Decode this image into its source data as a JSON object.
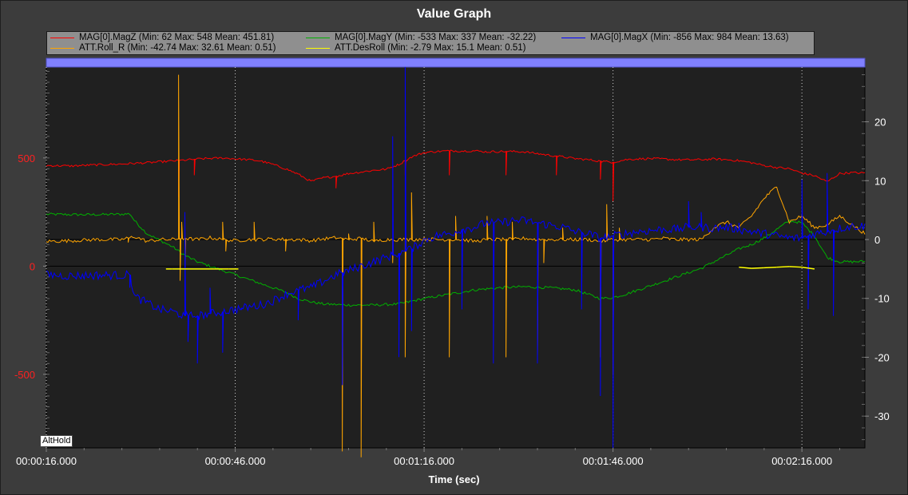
{
  "window": {
    "title": "Value Graph"
  },
  "badge": "AltHold",
  "colors": {
    "plot_bg": "#202020",
    "grid": "#cfcfcf",
    "topbar": "#8080ff"
  },
  "chart_data": {
    "type": "line",
    "title": "Value Graph",
    "xlabel": "Time (sec)",
    "ylabel": "",
    "xlim": [
      16,
      146
    ],
    "ylim_left": [
      -840,
      920
    ],
    "ylim_right": [
      -35.4,
      29.3
    ],
    "x_tick_labels": [
      "00:00:16.000",
      "00:00:46.000",
      "00:01:16.000",
      "00:01:46.000",
      "00:02:16.000"
    ],
    "x_tick_values": [
      16,
      46,
      76,
      106,
      136
    ],
    "y_left_ticks": [
      500,
      0,
      -500
    ],
    "y_left_tick_labels": [
      "500",
      "0",
      "-500"
    ],
    "y_right_ticks": [
      20,
      10,
      0,
      -10,
      -20,
      -30
    ],
    "y_right_tick_labels": [
      "20",
      "10",
      "0",
      "-10",
      "-20",
      "-30"
    ],
    "grid": true,
    "legend": "top",
    "series": [
      {
        "name": "MAG[0].MagZ",
        "legend_label": "MAG[0].MagZ  (Min: 62 Max: 548 Mean: 451.81)",
        "color": "#ff0000",
        "axis": "left",
        "x": [
          16,
          20,
          24,
          28,
          32,
          36,
          38,
          40,
          42,
          44,
          46,
          48,
          50,
          52,
          54,
          56,
          58,
          60,
          62,
          64,
          66,
          68,
          70,
          72,
          74,
          76,
          78,
          80,
          82,
          84,
          86,
          88,
          90,
          92,
          94,
          96,
          98,
          100,
          102,
          104,
          106,
          108,
          110,
          112,
          114,
          116,
          118,
          120,
          122,
          124,
          126,
          128,
          130,
          132,
          134,
          136,
          138,
          140,
          142,
          144,
          146
        ],
        "y": [
          465,
          463,
          468,
          472,
          478,
          486,
          490,
          495,
          498,
          500,
          496,
          492,
          486,
          470,
          450,
          425,
          392,
          408,
          415,
          428,
          435,
          443,
          448,
          470,
          505,
          525,
          530,
          533,
          532,
          533,
          528,
          530,
          530,
          528,
          520,
          512,
          505,
          497,
          492,
          485,
          480,
          492,
          496,
          497,
          495,
          492,
          491,
          492,
          495,
          492,
          487,
          478,
          465,
          456,
          450,
          430,
          418,
          390,
          428,
          432,
          430
        ]
      },
      {
        "name": "MAG[0].MagY",
        "legend_label": "MAG[0].MagY  (Min: -533 Max: 337 Mean: -32.22)",
        "color": "#00b000",
        "axis": "left",
        "x": [
          16,
          20,
          24,
          28,
          29.3,
          30,
          32,
          34,
          36,
          38,
          40,
          42,
          44,
          46,
          48,
          50,
          52,
          54,
          56,
          58,
          60,
          64,
          68,
          72,
          76,
          80,
          84,
          88,
          92,
          96,
          100,
          102,
          104,
          106,
          108,
          110,
          112,
          114,
          116,
          118,
          120,
          122,
          124,
          126,
          128,
          130,
          132,
          134,
          136,
          138,
          140,
          142,
          144,
          146
        ],
        "y": [
          240,
          238,
          238,
          240,
          242,
          210,
          150,
          120,
          90,
          50,
          20,
          0,
          -20,
          -40,
          -60,
          -80,
          -100,
          -120,
          -150,
          -165,
          -175,
          -180,
          -180,
          -175,
          -150,
          -130,
          -110,
          -100,
          -95,
          -100,
          -110,
          -130,
          -150,
          -145,
          -130,
          -110,
          -90,
          -70,
          -50,
          -30,
          -10,
          20,
          50,
          80,
          100,
          130,
          170,
          210,
          200,
          140,
          40,
          20,
          20,
          22
        ]
      },
      {
        "name": "MAG[0].MagX",
        "legend_label": "MAG[0].MagX  (Min: -856 Max: 984 Mean: 13.63)",
        "color": "#0000ff",
        "axis": "left",
        "x": [
          16,
          20,
          24,
          28,
          29.3,
          30,
          32,
          34,
          36,
          38,
          40,
          42,
          44,
          46,
          48,
          50,
          52,
          54,
          56,
          58,
          60,
          62,
          64,
          66,
          68,
          70,
          72,
          74,
          76,
          78,
          80,
          82,
          84,
          86,
          88,
          90,
          92,
          94,
          96,
          98,
          100,
          102,
          104,
          106,
          108,
          110,
          112,
          114,
          116,
          118,
          120,
          122,
          124,
          126,
          128,
          130,
          132,
          134,
          136,
          138,
          140,
          142,
          144,
          146
        ],
        "y": [
          -40,
          -45,
          -42,
          -42,
          -40,
          -140,
          -170,
          -200,
          -210,
          -230,
          -230,
          -220,
          -210,
          -200,
          -190,
          -180,
          -160,
          -130,
          -110,
          -100,
          -70,
          -40,
          -20,
          0,
          20,
          40,
          60,
          80,
          120,
          140,
          150,
          170,
          180,
          200,
          200,
          210,
          210,
          200,
          190,
          180,
          160,
          150,
          130,
          140,
          150,
          160,
          165,
          170,
          170,
          180,
          180,
          175,
          180,
          170,
          160,
          150,
          140,
          130,
          130,
          150,
          160,
          175,
          185,
          185
        ]
      },
      {
        "name": "ATT.Roll_R",
        "legend_label": "ATT.Roll_R  (Min: -42.74 Max: 32.61 Mean: 0.51)",
        "color": "#ffa500",
        "axis": "right",
        "x": [
          16,
          20,
          24,
          28,
          30,
          32,
          34,
          36,
          38,
          40,
          42,
          44,
          46,
          48,
          50,
          52,
          54,
          56,
          58,
          60,
          62,
          64,
          66,
          68,
          70,
          72,
          74,
          76,
          78,
          80,
          82,
          84,
          86,
          88,
          90,
          92,
          94,
          96,
          98,
          100,
          102,
          104,
          106,
          108,
          110,
          112,
          114,
          116,
          118,
          120,
          122,
          124,
          126,
          128,
          130,
          132,
          134,
          136,
          138,
          140,
          142,
          144,
          146
        ],
        "y": [
          -0.3,
          -0.2,
          0,
          0,
          0.5,
          -0.3,
          0,
          0,
          0.2,
          0,
          0.3,
          0,
          -0.2,
          0,
          0,
          0.1,
          0,
          0,
          -0.2,
          0.1,
          0.3,
          0,
          0.2,
          -0.3,
          0,
          0,
          0,
          0.1,
          0,
          0,
          0,
          -0.3,
          0,
          0,
          0,
          0.2,
          0,
          0,
          0,
          0,
          0,
          -0.3,
          0,
          0,
          0,
          0,
          0.2,
          0,
          0,
          0,
          2,
          3,
          2,
          4,
          7,
          9,
          3,
          4,
          2,
          2.5,
          4,
          2.5,
          1
        ]
      },
      {
        "name": "ATT.DesRoll",
        "legend_label": "ATT.DesRoll  (Min: -2.79 Max: 15.1 Mean: 0.51)",
        "color": "#ffff00",
        "axis": "right",
        "x": [
          35,
          36,
          45,
          46.5,
          126,
          128,
          130,
          132,
          134,
          136,
          138
        ],
        "y": [
          -5,
          -5,
          -5,
          -5,
          -4.7,
          -4.9,
          -4.8,
          -4.7,
          -4.6,
          -4.7,
          -5
        ]
      }
    ],
    "spikes": {
      "MagX": [
        [
          29.3,
          -100
        ],
        [
          38,
          250
        ],
        [
          38.5,
          -350
        ],
        [
          40,
          -450
        ],
        [
          42,
          -100
        ],
        [
          44,
          -400
        ],
        [
          47,
          -200
        ],
        [
          56,
          -250
        ],
        [
          63,
          -550
        ],
        [
          71,
          600
        ],
        [
          72,
          -420
        ],
        [
          73,
          920
        ],
        [
          74,
          -300
        ],
        [
          82,
          -200
        ],
        [
          87,
          -450
        ],
        [
          94,
          -450
        ],
        [
          101,
          -200
        ],
        [
          104,
          -600
        ],
        [
          106,
          -840
        ],
        [
          118,
          300
        ],
        [
          120,
          250
        ],
        [
          126,
          200
        ],
        [
          136,
          400
        ],
        [
          137,
          -200
        ],
        [
          140,
          430
        ],
        [
          141,
          -230
        ]
      ],
      "MagZ": [
        [
          37,
          320
        ],
        [
          39.5,
          420
        ],
        [
          62,
          360
        ],
        [
          73,
          420
        ],
        [
          80,
          420
        ],
        [
          89,
          420
        ],
        [
          97,
          420
        ],
        [
          104,
          400
        ],
        [
          106,
          300
        ]
      ],
      "Roll": [
        [
          29,
          -0.5
        ],
        [
          37,
          28
        ],
        [
          37.3,
          -7
        ],
        [
          37.6,
          3
        ],
        [
          38,
          -8
        ],
        [
          44,
          3
        ],
        [
          44.5,
          -2
        ],
        [
          49,
          3
        ],
        [
          54,
          -2
        ],
        [
          63,
          -36
        ],
        [
          64,
          1
        ],
        [
          66,
          -37
        ],
        [
          68,
          3
        ],
        [
          71,
          -4
        ],
        [
          73,
          -20
        ],
        [
          74,
          8
        ],
        [
          80,
          -20
        ],
        [
          81,
          4
        ],
        [
          86,
          4
        ],
        [
          89,
          -20
        ],
        [
          90,
          3
        ],
        [
          94,
          -20
        ],
        [
          95,
          -4
        ],
        [
          98,
          2
        ],
        [
          104,
          -20
        ],
        [
          105,
          6
        ],
        [
          106,
          -23
        ],
        [
          107,
          2
        ]
      ]
    }
  }
}
